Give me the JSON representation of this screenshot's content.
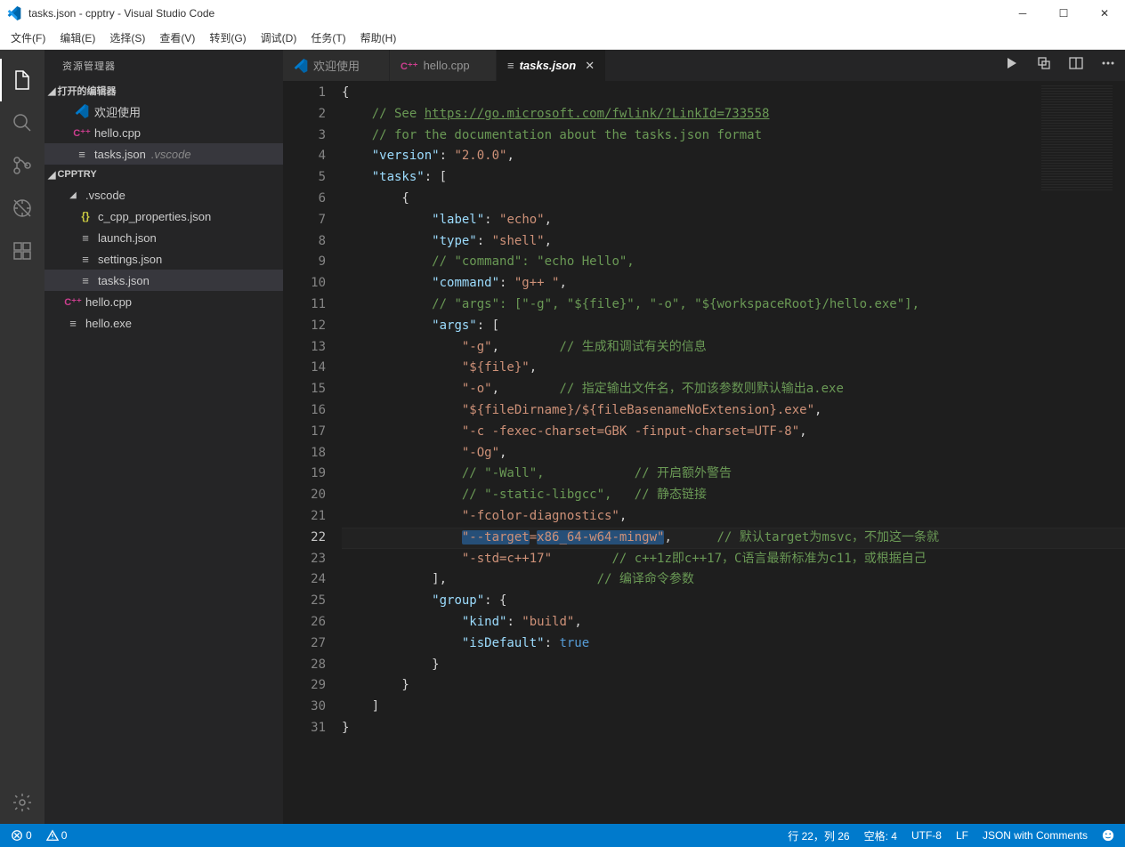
{
  "window": {
    "title": "tasks.json - cpptry - Visual Studio Code"
  },
  "menu": [
    "文件(F)",
    "编辑(E)",
    "选择(S)",
    "查看(V)",
    "转到(G)",
    "调试(D)",
    "任务(T)",
    "帮助(H)"
  ],
  "sidebar": {
    "title": "资源管理器",
    "openEditors": {
      "label": "打开的编辑器",
      "items": [
        {
          "icon": "vscode",
          "label": "欢迎使用"
        },
        {
          "icon": "cpp",
          "label": "hello.cpp"
        },
        {
          "icon": "json",
          "label": "tasks.json",
          "dim": ".vscode",
          "selected": true
        }
      ]
    },
    "folder": {
      "label": "CPPTRY",
      "items": [
        {
          "depth": 0,
          "type": "folder-open",
          "label": ".vscode"
        },
        {
          "depth": 1,
          "type": "json-y",
          "label": "c_cpp_properties.json"
        },
        {
          "depth": 1,
          "type": "json",
          "label": "launch.json"
        },
        {
          "depth": 1,
          "type": "json",
          "label": "settings.json"
        },
        {
          "depth": 1,
          "type": "json",
          "label": "tasks.json",
          "selected": true
        },
        {
          "depth": 0,
          "type": "cpp",
          "label": "hello.cpp"
        },
        {
          "depth": 0,
          "type": "exe",
          "label": "hello.exe"
        }
      ]
    }
  },
  "tabs": [
    {
      "icon": "vscode",
      "label": "欢迎使用"
    },
    {
      "icon": "cpp",
      "label": "hello.cpp"
    },
    {
      "icon": "json",
      "label": "tasks.json",
      "active": true,
      "closable": true
    }
  ],
  "code": {
    "lines": [
      [
        {
          "t": "{",
          "c": "punc"
        }
      ],
      [
        {
          "t": "    ",
          "c": ""
        },
        {
          "t": "// See ",
          "c": "cmt"
        },
        {
          "t": "https://go.microsoft.com/fwlink/?LinkId=733558",
          "c": "link"
        }
      ],
      [
        {
          "t": "    ",
          "c": ""
        },
        {
          "t": "// for the documentation about the tasks.json format",
          "c": "cmt"
        }
      ],
      [
        {
          "t": "    ",
          "c": ""
        },
        {
          "t": "\"version\"",
          "c": "key"
        },
        {
          "t": ": ",
          "c": "punc"
        },
        {
          "t": "\"2.0.0\"",
          "c": "str"
        },
        {
          "t": ",",
          "c": "punc"
        }
      ],
      [
        {
          "t": "    ",
          "c": ""
        },
        {
          "t": "\"tasks\"",
          "c": "key"
        },
        {
          "t": ": [",
          "c": "punc"
        }
      ],
      [
        {
          "t": "        {",
          "c": "punc"
        }
      ],
      [
        {
          "t": "            ",
          "c": ""
        },
        {
          "t": "\"label\"",
          "c": "key"
        },
        {
          "t": ": ",
          "c": "punc"
        },
        {
          "t": "\"echo\"",
          "c": "str"
        },
        {
          "t": ",",
          "c": "punc"
        }
      ],
      [
        {
          "t": "            ",
          "c": ""
        },
        {
          "t": "\"type\"",
          "c": "key"
        },
        {
          "t": ": ",
          "c": "punc"
        },
        {
          "t": "\"shell\"",
          "c": "str"
        },
        {
          "t": ",",
          "c": "punc"
        }
      ],
      [
        {
          "t": "            ",
          "c": ""
        },
        {
          "t": "// \"command\": \"echo Hello\",",
          "c": "cmt"
        }
      ],
      [
        {
          "t": "            ",
          "c": ""
        },
        {
          "t": "\"command\"",
          "c": "key"
        },
        {
          "t": ": ",
          "c": "punc"
        },
        {
          "t": "\"g++ \"",
          "c": "str"
        },
        {
          "t": ",",
          "c": "punc"
        }
      ],
      [
        {
          "t": "            ",
          "c": ""
        },
        {
          "t": "// \"args\": [\"-g\", \"${file}\", \"-o\", \"${workspaceRoot}/hello.exe\"],",
          "c": "cmt"
        }
      ],
      [
        {
          "t": "            ",
          "c": ""
        },
        {
          "t": "\"args\"",
          "c": "key"
        },
        {
          "t": ": [",
          "c": "punc"
        }
      ],
      [
        {
          "t": "                ",
          "c": ""
        },
        {
          "t": "\"-g\"",
          "c": "str"
        },
        {
          "t": ",",
          "c": "punc"
        },
        {
          "t": "        ",
          "c": ""
        },
        {
          "t": "// 生成和调试有关的信息",
          "c": "cmt"
        }
      ],
      [
        {
          "t": "                ",
          "c": ""
        },
        {
          "t": "\"${file}\"",
          "c": "str"
        },
        {
          "t": ",",
          "c": "punc"
        }
      ],
      [
        {
          "t": "                ",
          "c": ""
        },
        {
          "t": "\"-o\"",
          "c": "str"
        },
        {
          "t": ",",
          "c": "punc"
        },
        {
          "t": "        ",
          "c": ""
        },
        {
          "t": "// 指定输出文件名，不加该参数则默认输出a.exe",
          "c": "cmt"
        }
      ],
      [
        {
          "t": "                ",
          "c": ""
        },
        {
          "t": "\"${fileDirname}/${fileBasenameNoExtension}.exe\"",
          "c": "str"
        },
        {
          "t": ",",
          "c": "punc"
        }
      ],
      [
        {
          "t": "                ",
          "c": ""
        },
        {
          "t": "\"-c -fexec-charset=GBK -finput-charset=UTF-8\"",
          "c": "str"
        },
        {
          "t": ",",
          "c": "punc"
        }
      ],
      [
        {
          "t": "                ",
          "c": ""
        },
        {
          "t": "\"-Og\"",
          "c": "str"
        },
        {
          "t": ",",
          "c": "punc"
        }
      ],
      [
        {
          "t": "                ",
          "c": ""
        },
        {
          "t": "// \"-Wall\",            // 开启额外警告",
          "c": "cmt"
        }
      ],
      [
        {
          "t": "                ",
          "c": ""
        },
        {
          "t": "// \"-static-libgcc\",   // 静态链接",
          "c": "cmt"
        }
      ],
      [
        {
          "t": "                ",
          "c": ""
        },
        {
          "t": "\"-fcolor-diagnostics\"",
          "c": "str"
        },
        {
          "t": ",",
          "c": "punc"
        }
      ],
      [
        {
          "t": "                ",
          "c": ""
        },
        {
          "t": "\"--target",
          "c": "str",
          "sel": true
        },
        {
          "t": "=",
          "c": "str",
          "cur": true
        },
        {
          "t": "x86_64-w64-mingw\"",
          "c": "str",
          "sel": true
        },
        {
          "t": ",",
          "c": "punc"
        },
        {
          "t": "      ",
          "c": ""
        },
        {
          "t": "// 默认target为msvc，不加这一条就",
          "c": "cmt"
        }
      ],
      [
        {
          "t": "                ",
          "c": ""
        },
        {
          "t": "\"-std=c++17\"",
          "c": "str"
        },
        {
          "t": "        ",
          "c": ""
        },
        {
          "t": "// c++1z即c++17，C语言最新标准为c11，或根据自己",
          "c": "cmt"
        }
      ],
      [
        {
          "t": "            ],",
          "c": "punc"
        },
        {
          "t": "                    ",
          "c": ""
        },
        {
          "t": "// 编译命令参数",
          "c": "cmt"
        }
      ],
      [
        {
          "t": "            ",
          "c": ""
        },
        {
          "t": "\"group\"",
          "c": "key"
        },
        {
          "t": ": {",
          "c": "punc"
        }
      ],
      [
        {
          "t": "                ",
          "c": ""
        },
        {
          "t": "\"kind\"",
          "c": "key"
        },
        {
          "t": ": ",
          "c": "punc"
        },
        {
          "t": "\"build\"",
          "c": "str"
        },
        {
          "t": ",",
          "c": "punc"
        }
      ],
      [
        {
          "t": "                ",
          "c": ""
        },
        {
          "t": "\"isDefault\"",
          "c": "key"
        },
        {
          "t": ": ",
          "c": "punc"
        },
        {
          "t": "true",
          "c": "bool"
        }
      ],
      [
        {
          "t": "            }",
          "c": "punc"
        }
      ],
      [
        {
          "t": "        }",
          "c": "punc"
        }
      ],
      [
        {
          "t": "    ]",
          "c": "punc"
        }
      ],
      [
        {
          "t": "}",
          "c": "punc"
        }
      ]
    ],
    "currentLine": 22
  },
  "status": {
    "errors": "0",
    "warnings": "0",
    "pos": "行 22，列 26",
    "spaces": "空格: 4",
    "enc": "UTF-8",
    "eol": "LF",
    "lang": "JSON with Comments"
  }
}
